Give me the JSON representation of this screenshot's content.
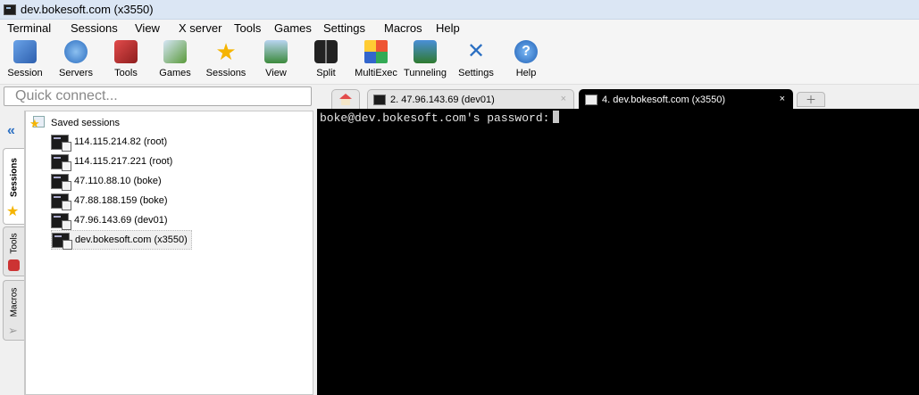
{
  "window": {
    "title": "dev.bokesoft.com (x3550)"
  },
  "menu": [
    "Terminal",
    "Sessions",
    "View",
    "X server",
    "Tools",
    "Games",
    "Settings",
    "Macros",
    "Help"
  ],
  "toolbar": [
    {
      "label": "Session",
      "icon": "session-icon"
    },
    {
      "label": "Servers",
      "icon": "servers-icon"
    },
    {
      "label": "Tools",
      "icon": "tools-icon"
    },
    {
      "label": "Games",
      "icon": "games-icon"
    },
    {
      "label": "Sessions",
      "icon": "sessions-star-icon"
    },
    {
      "label": "View",
      "icon": "view-icon"
    },
    {
      "label": "Split",
      "icon": "split-icon"
    },
    {
      "label": "MultiExec",
      "icon": "multiexec-icon"
    },
    {
      "label": "Tunneling",
      "icon": "tunneling-icon"
    },
    {
      "label": "Settings",
      "icon": "settings-icon"
    },
    {
      "label": "Help",
      "icon": "help-icon"
    }
  ],
  "quick_connect": {
    "placeholder": "Quick connect..."
  },
  "side_tabs": {
    "sessions": "Sessions",
    "tools": "Tools",
    "macros": "Macros"
  },
  "sessions": {
    "root_label": "Saved sessions",
    "items": [
      {
        "label": "114.115.214.82 (root)"
      },
      {
        "label": "114.115.217.221 (root)"
      },
      {
        "label": "47.110.88.10 (boke)"
      },
      {
        "label": "47.88.188.159 (boke)"
      },
      {
        "label": "47.96.143.69 (dev01)"
      },
      {
        "label": "dev.bokesoft.com (x3550)",
        "selected": true
      }
    ]
  },
  "tabs": [
    {
      "label": "2. 47.96.143.69 (dev01)",
      "active": false,
      "close": "×"
    },
    {
      "label": "4. dev.bokesoft.com (x3550)",
      "active": true,
      "close": "×"
    }
  ],
  "terminal": {
    "line": "boke@dev.bokesoft.com's password:"
  },
  "colors": {
    "title_bar": "#dbe6f4",
    "terminal_bg": "#000000",
    "active_tab": "#000000",
    "accent_blue": "#2b6fc2"
  }
}
